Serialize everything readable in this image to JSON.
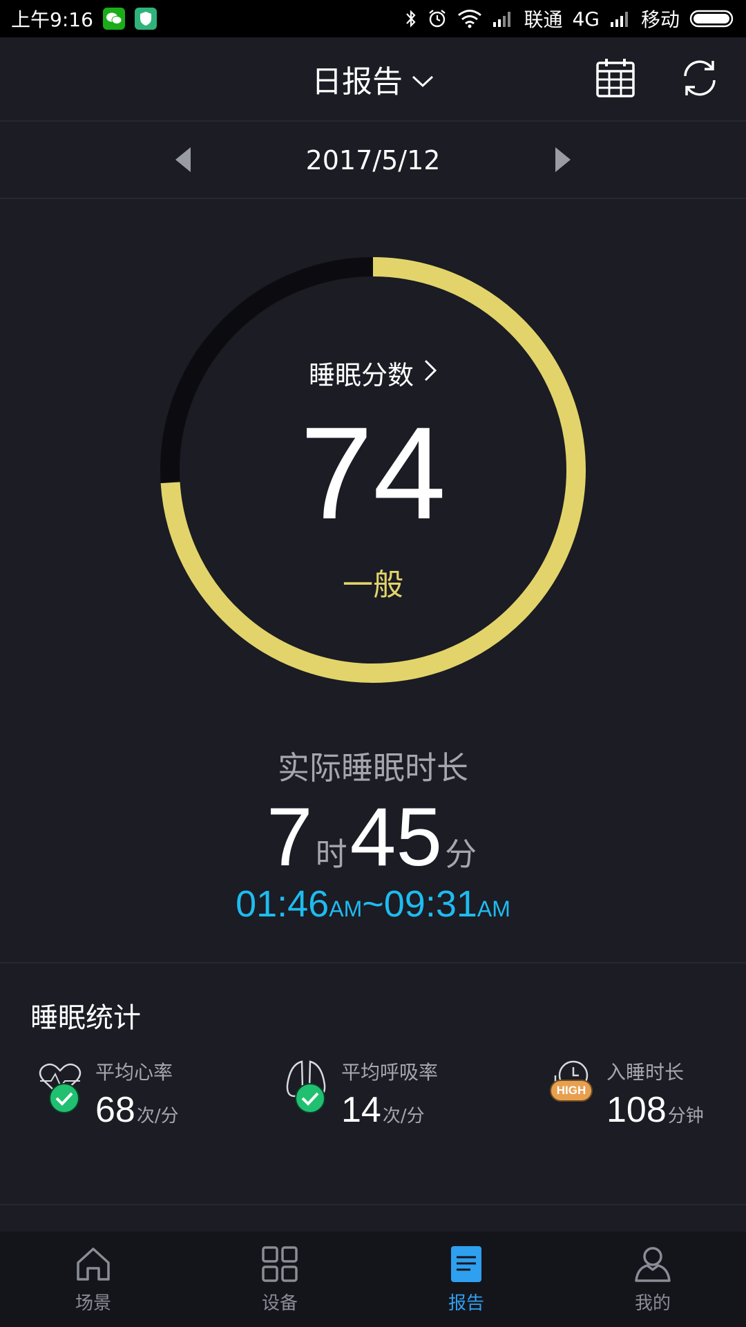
{
  "status_bar": {
    "time": "上午9:16",
    "carrier1": "联通",
    "network": "4G",
    "carrier2": "移动",
    "icons": [
      "wechat-icon",
      "shield-app-icon",
      "bluetooth-icon",
      "alarm-icon",
      "wifi-icon",
      "signal-icon",
      "battery-icon"
    ]
  },
  "header": {
    "title": "日报告",
    "icons": [
      "chevron-down-icon",
      "calendar-icon",
      "refresh-icon"
    ]
  },
  "date_nav": {
    "date": "2017/5/12",
    "icons": [
      "prev-arrow-icon",
      "next-arrow-icon"
    ]
  },
  "score": {
    "label": "睡眠分数",
    "value": "74",
    "rating": "一般",
    "ring_fraction": 0.74
  },
  "duration": {
    "title": "实际睡眠时长",
    "hours": "7",
    "hour_unit": "时",
    "minutes": "45",
    "minute_unit": "分",
    "start_time": "01:46",
    "start_suffix": "AM",
    "separator": "~",
    "end_time": "09:31",
    "end_suffix": "AM"
  },
  "stats": {
    "title": "睡眠统计",
    "items": [
      {
        "label": "平均心率",
        "value": "68",
        "unit": "次/分",
        "icon": "heart-icon",
        "status_icon": "check-icon"
      },
      {
        "label": "平均呼吸率",
        "value": "14",
        "unit": "次/分",
        "icon": "lungs-icon",
        "status_icon": "check-icon"
      },
      {
        "label": "入睡时长",
        "value": "108",
        "unit": "分钟",
        "icon": "clock-icon",
        "status_badge": "HIGH"
      }
    ]
  },
  "bottom_nav": {
    "items": [
      {
        "label": "场景",
        "icon": "home-icon"
      },
      {
        "label": "设备",
        "icon": "grid-icon"
      },
      {
        "label": "报告",
        "icon": "report-icon",
        "active": true
      },
      {
        "label": "我的",
        "icon": "profile-icon"
      }
    ]
  },
  "colors": {
    "background": "#1b1c24",
    "ring_accent": "#e2d46a",
    "ring_track": "#0c0c10",
    "time_range": "#1ebcf0",
    "active_nav": "#2f9ff0",
    "inactive_nav": "#8a8d96",
    "good_status": "#20c070",
    "high_badge": "#e8a050"
  }
}
